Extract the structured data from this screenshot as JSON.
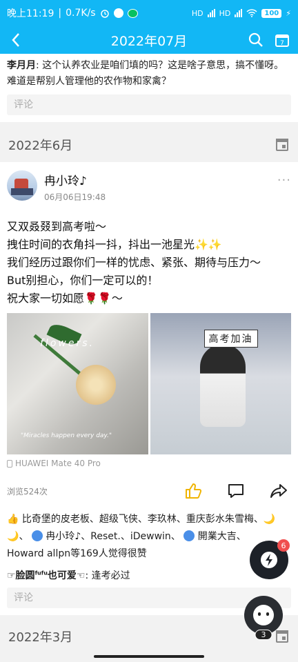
{
  "status_bar": {
    "time": "晚上11:19",
    "speed": "0.7K/s",
    "net1": "HD",
    "net2": "HD",
    "battery": "100"
  },
  "nav": {
    "title": "2022年07月",
    "back_icon": "back-arrow-icon",
    "search_icon": "search-icon",
    "calendar_icon": "calendar-icon",
    "calendar_day": "7"
  },
  "prev_post": {
    "comment_author": "李月月",
    "comment_text": ": 这个认养农业是咱们填的吗？这是啥子意思，搞不懂呀。难道是帮别人管理他的农作物和家禽？",
    "comment_placeholder": "评论"
  },
  "month_header_1": "2022年6月",
  "post": {
    "author": "冉小玲♪",
    "time": "06月06日19:48",
    "more": "···",
    "body_lines": [
      "又双叒叕到高考啦～",
      "拽住时间的衣角抖一抖，抖出一池星光✨✨",
      "我们经历过跟你们一样的忧虑、紧张、期待与压力～",
      "But别担心，你们一定可以的！",
      "祝大家一切如愿🌹🌹～"
    ],
    "photo1_overlay": "flowers.",
    "photo1_caption": "\"Miracles happen every day.\"",
    "photo2_overlay": "高考加油",
    "device": "HUAWEI Mate 40 Pro",
    "views": "浏览524次",
    "likes_text_1": "比奇堡的皮老板、超级飞侠、李玖林、重庆彭水朱雪梅、",
    "likes_text_2": "、",
    "likes_text_3": "冉小玲♪、Reset.、iDewwin、",
    "likes_text_4": "開業大吉、",
    "likes_text_5": "Howard  allpn等169人觉得很赞",
    "comment2_author_a": "☞脸圆",
    "comment2_sup": "fufu",
    "comment2_author_b": "也可爱☜",
    "comment2_text": ": 逢考必过",
    "comment_placeholder": "评论"
  },
  "month_header_2": "2022年3月",
  "float_badge": "6",
  "bot_count": "3",
  "colors": {
    "accent": "#12b7f5",
    "badge": "#f04e4e",
    "like": "#f0b400"
  }
}
